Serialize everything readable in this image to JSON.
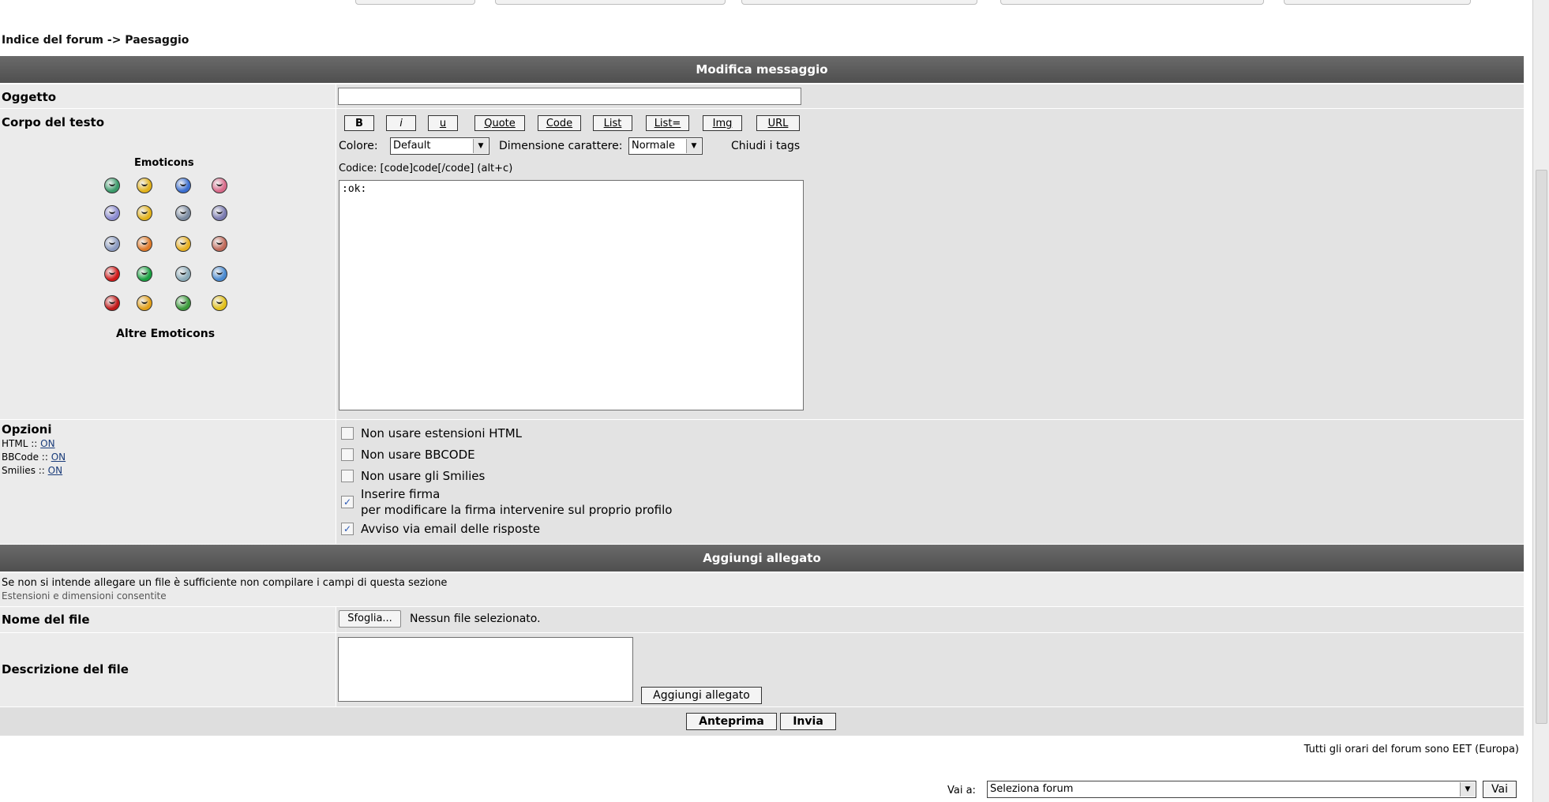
{
  "breadcrumb": "Indice del forum -> Paesaggio",
  "edit_section": {
    "header": "Modifica messaggio",
    "subject_label": "Oggetto",
    "subject_value": "",
    "body_label": "Corpo del testo",
    "emoticons_title": "Emoticons",
    "more_emoticons": "Altre Emoticons",
    "bbcode_buttons": [
      "B",
      "i",
      "u",
      "Quote",
      "Code",
      "List",
      "List=",
      "Img",
      "URL"
    ],
    "color_label": "Colore:",
    "color_value": "Default",
    "size_label": "Dimensione carattere:",
    "size_value": "Normale",
    "close_tags": "Chiudi i tags",
    "hint": "Codice: [code]code[/code] (alt+c)",
    "message_text": ":ok:"
  },
  "options": {
    "label": "Opzioni",
    "html_status_label": "HTML ::",
    "html_status": "ON",
    "bbcode_status_label": "BBCode ::",
    "bbcode_status": "ON",
    "smilies_status_label": "Smilies ::",
    "smilies_status": "ON",
    "checkboxes": [
      {
        "label": "Non usare estensioni HTML",
        "checked": false
      },
      {
        "label": "Non usare BBCODE",
        "checked": false
      },
      {
        "label": "Non usare gli Smilies",
        "checked": false
      },
      {
        "label": "Inserire firma",
        "sub": "per modificare la firma intervenire sul proprio profilo",
        "checked": true
      },
      {
        "label": "Avviso via email delle risposte",
        "checked": true
      }
    ]
  },
  "attachment": {
    "header": "Aggiungi allegato",
    "info": "Se non si intende allegare un file è sufficiente non compilare i campi di questa sezione",
    "extensions_link": "Estensioni e dimensioni consentite",
    "filename_label": "Nome del file",
    "browse_button": "Sfoglia...",
    "no_file": "Nessun file selezionato.",
    "description_label": "Descrizione del file",
    "add_button": "Aggiungi allegato"
  },
  "actions": {
    "preview": "Anteprima",
    "submit": "Invia"
  },
  "footer": {
    "timezone": "Tutti gli orari del forum sono EET (Europa)",
    "jump_label": "Vai a:",
    "jump_value": "Seleziona forum",
    "go_button": "Vai"
  },
  "colors": {
    "header_bg": "#5a5a5a",
    "row_bg": "#ebebeb",
    "cell_bg": "#e3e3e3"
  },
  "emoticon_colors": [
    [
      "#3a9a6a",
      "#e2b21a",
      "#3a6ed0",
      "#d86a8a"
    ],
    [
      "#8a8ad0",
      "#e2b21a",
      "#7a8aa0",
      "#7a7ab0"
    ],
    [
      "#8a9ac0",
      "#e07a2a",
      "#e8b020",
      "#c06a5a"
    ],
    [
      "#d01818",
      "#18a040",
      "#8aaab8",
      "#4a8ad0"
    ],
    [
      "#c01818",
      "#e2a01a",
      "#3a9a3a",
      "#e2c01a"
    ]
  ]
}
